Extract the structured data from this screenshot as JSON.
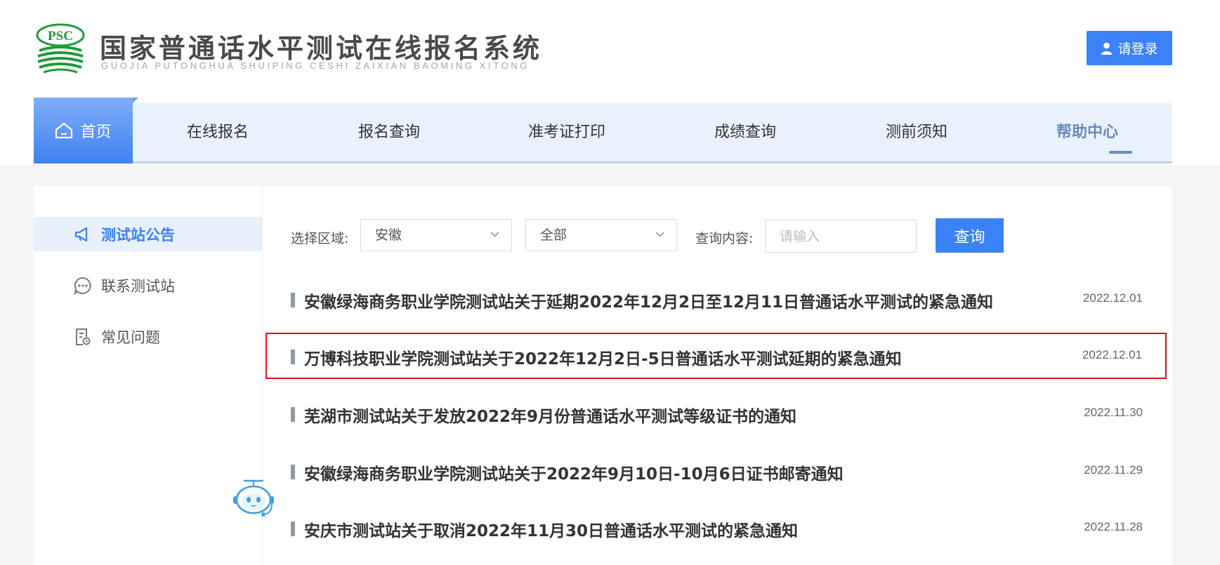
{
  "header": {
    "logo_text": "PSC",
    "title": "国家普通话水平测试在线报名系统",
    "subtitle": "GUOJIA PUTONGHUA SHUIPING CESHI ZAIXIAN BAOMING XITONG",
    "login_label": "请登录"
  },
  "nav": {
    "home": "首页",
    "items": [
      "在线报名",
      "报名查询",
      "准考证打印",
      "成绩查询",
      "测前须知",
      "帮助中心"
    ]
  },
  "sidebar": {
    "items": [
      {
        "label": "测试站公告",
        "icon": "megaphone-icon",
        "active": true
      },
      {
        "label": "联系测试站",
        "icon": "chat-icon",
        "active": false
      },
      {
        "label": "常见问题",
        "icon": "document-icon",
        "active": false
      }
    ]
  },
  "filter": {
    "region_label": "选择区域:",
    "region_value": "安徽",
    "category_value": "全部",
    "query_label": "查询内容:",
    "query_placeholder": "请输入",
    "query_button": "查询"
  },
  "notices": [
    {
      "title": "安徽绿海商务职业学院测试站关于延期2022年12月2日至12月11日普通话水平测试的紧急通知",
      "date": "2022.12.01",
      "highlighted": false
    },
    {
      "title": "万博科技职业学院测试站关于2022年12月2日-5日普通话水平测试延期的紧急通知",
      "date": "2022.12.01",
      "highlighted": true
    },
    {
      "title": "芜湖市测试站关于发放2022年9月份普通话水平测试等级证书的通知",
      "date": "2022.11.30",
      "highlighted": false
    },
    {
      "title": "安徽绿海商务职业学院测试站关于2022年9月10日-10月6日证书邮寄通知",
      "date": "2022.11.29",
      "highlighted": false
    },
    {
      "title": "安庆市测试站关于取消2022年11月30日普通话水平测试的紧急通知",
      "date": "2022.11.28",
      "highlighted": false
    }
  ],
  "colors": {
    "accent": "#3b82f6",
    "nav_bg": "#e9f1fc",
    "highlight_border": "#d0151c",
    "logo_green": "#1f9a3a"
  }
}
